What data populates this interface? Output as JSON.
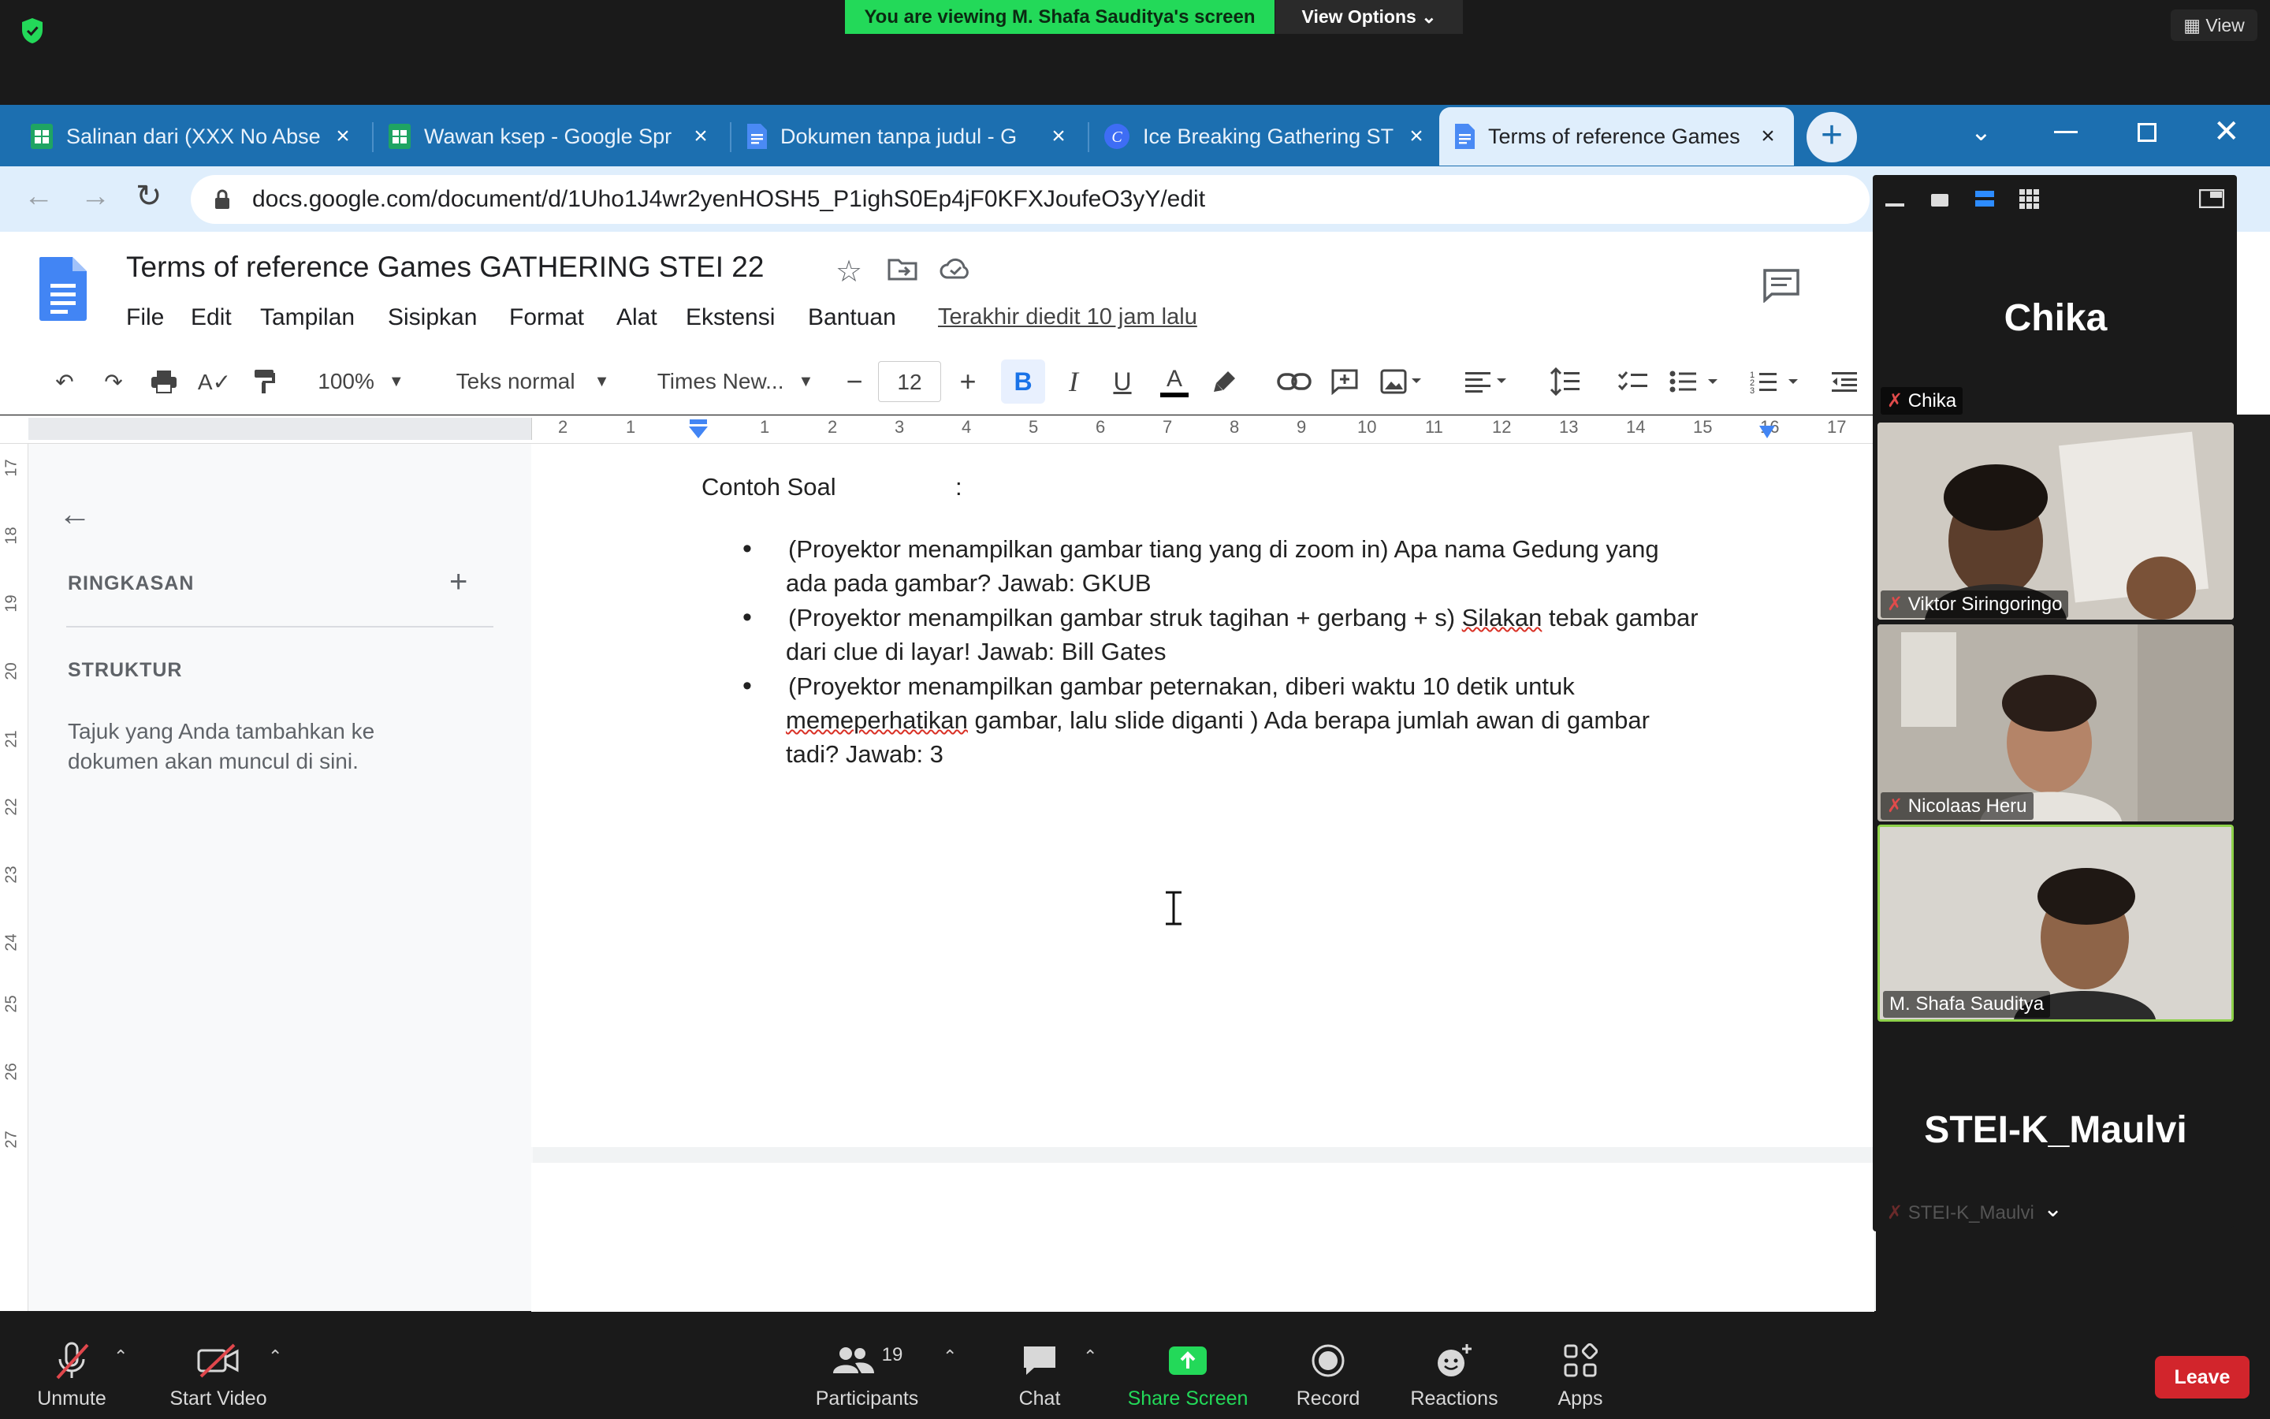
{
  "zoom": {
    "banner": "You are viewing M. Shafa Sauditya's screen",
    "view_options": "View Options ⌄",
    "view_label": "View",
    "bottom": {
      "unmute": "Unmute",
      "start_video": "Start Video",
      "participants": "Participants",
      "participants_count": "19",
      "chat": "Chat",
      "share_screen": "Share Screen",
      "record": "Record",
      "reactions": "Reactions",
      "apps": "Apps",
      "leave": "Leave"
    },
    "participants": [
      {
        "name": "Chika",
        "big_label": "Chika"
      },
      {
        "name": "Viktor Siringoringo"
      },
      {
        "name": "Nicolaas Heru"
      },
      {
        "name": "M. Shafa Sauditya"
      },
      {
        "name": "STEI-K_Maulvi",
        "big_label": "STEI-K_Maulvi"
      }
    ],
    "colors": {
      "banner": "#23d959",
      "leave": "#d2252c",
      "active_speaker": "#8ed14a"
    }
  },
  "browser": {
    "tabs": [
      {
        "title": "Salinan dari (XXX No Abse",
        "icon": "sheets-icon"
      },
      {
        "title": "Wawan ksep - Google Spr",
        "icon": "sheets-icon"
      },
      {
        "title": "Dokumen tanpa judul - G",
        "icon": "docs-icon"
      },
      {
        "title": "Ice Breaking Gathering ST",
        "icon": "canva-icon"
      },
      {
        "title": "Terms of reference Games",
        "icon": "docs-icon"
      }
    ],
    "url": "docs.google.com/document/d/1Uho1J4wr2yenHOSH5_P1ighS0Ep4jF0KFXJoufeO3yY/edit"
  },
  "docs": {
    "title": "Terms of reference Games GATHERING STEI 22",
    "menu": [
      "File",
      "Edit",
      "Tampilan",
      "Sisipkan",
      "Format",
      "Alat",
      "Ekstensi",
      "Bantuan"
    ],
    "last_edit": "Terakhir diedit 10 jam lalu",
    "toolbar": {
      "zoom": "100%",
      "style": "Teks normal",
      "font": "Times New...",
      "size": "12"
    },
    "ruler_h": [
      "2",
      "1",
      "1",
      "2",
      "3",
      "4",
      "5",
      "6",
      "7",
      "8",
      "9",
      "10",
      "11",
      "12",
      "13",
      "14",
      "15",
      "16",
      "17"
    ],
    "ruler_v": [
      "17",
      "18",
      "19",
      "20",
      "21",
      "22",
      "23",
      "24",
      "25",
      "26",
      "27"
    ],
    "outline": {
      "summary": "RINGKASAN",
      "structure": "STRUKTUR",
      "hint1": "Tajuk yang Anda tambahkan ke",
      "hint2": "dokumen akan muncul di sini."
    },
    "content": {
      "heading": "Contoh Soal",
      "colon": ":",
      "b1_l1": "(Proyektor menampilkan gambar tiang yang di zoom in) Apa nama Gedung yang",
      "b1_l2": "ada pada gambar? Jawab: GKUB",
      "b2_l1a": "(Proyektor menampilkan gambar struk tagihan + gerbang + s) ",
      "b2_l1b": "Silakan",
      "b2_l1c": " tebak gambar",
      "b2_l2": "dari clue di layar! Jawab: Bill Gates",
      "b3_l1": "(Proyektor menampilkan gambar peternakan, diberi waktu 10 detik untuk",
      "b3_l2a": "memeperhatikan",
      "b3_l2b": " gambar, lalu slide diganti ) Ada berapa jumlah awan di gambar",
      "b3_l3": "tadi? Jawab: 3"
    }
  }
}
